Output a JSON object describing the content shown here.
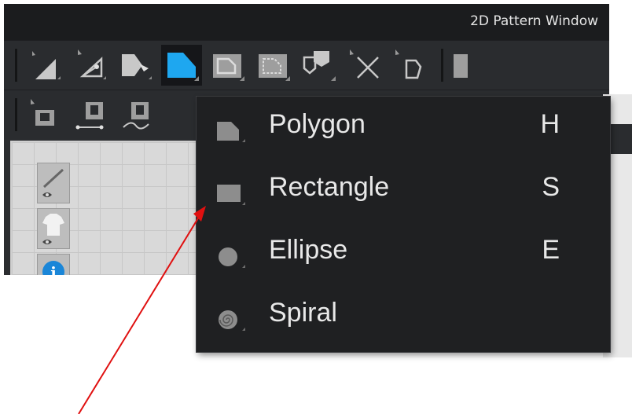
{
  "window": {
    "title": "2D Pattern Window"
  },
  "toolbar_row1": {
    "tools": [
      {
        "icon": "select-triangle-icon"
      },
      {
        "icon": "edit-point-icon"
      },
      {
        "icon": "transform-pattern-icon"
      },
      {
        "icon": "polygon-tool-icon",
        "active": true
      },
      {
        "icon": "internal-rectangle-icon"
      },
      {
        "icon": "internal-polygon-icon"
      },
      {
        "icon": "trace-icon"
      },
      {
        "icon": "cut-icon"
      },
      {
        "icon": "add-point-icon"
      }
    ]
  },
  "toolbar_row2": {
    "tools": [
      {
        "icon": "sewing-tool-icon"
      },
      {
        "icon": "segment-sewing-icon"
      },
      {
        "icon": "free-sewing-icon"
      }
    ]
  },
  "side_panel": {
    "buttons": [
      {
        "icon": "needle-visibility-icon"
      },
      {
        "icon": "garment-visibility-icon"
      },
      {
        "icon": "info-icon"
      }
    ]
  },
  "menu": {
    "items": [
      {
        "label": "Polygon",
        "shortcut": "H",
        "icon": "polygon-icon"
      },
      {
        "label": "Rectangle",
        "shortcut": "S",
        "icon": "rectangle-icon"
      },
      {
        "label": "Ellipse",
        "shortcut": "E",
        "icon": "ellipse-icon"
      },
      {
        "label": "Spiral",
        "shortcut": "",
        "icon": "spiral-icon"
      }
    ]
  },
  "annotation": {
    "arrow_color": "#e01010"
  },
  "colors": {
    "active_tool": "#1ea7f0",
    "menu_bg": "#1f2022",
    "toolbar_bg": "#2a2c2f"
  }
}
